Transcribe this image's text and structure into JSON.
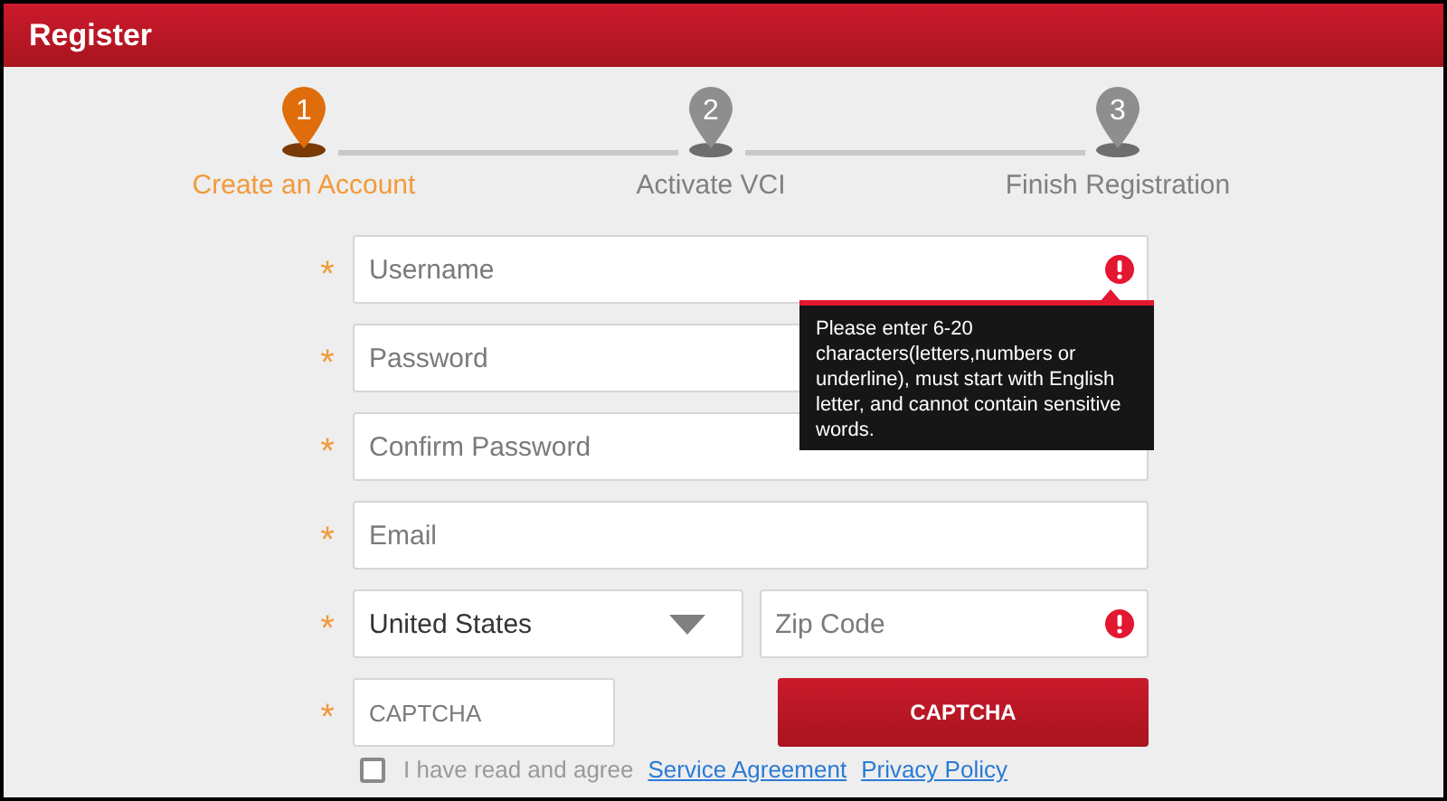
{
  "header": {
    "title": "Register"
  },
  "steps": [
    {
      "number": "1",
      "label": "Create an Account",
      "selected": true
    },
    {
      "number": "2",
      "label": "Activate VCI",
      "selected": false
    },
    {
      "number": "3",
      "label": "Finish Registration",
      "selected": false
    }
  ],
  "form_rows": [
    {
      "kind": "full",
      "required_mark": "*",
      "items": [
        {
          "kind": "input",
          "placeholder": "Username",
          "error": true
        }
      ]
    },
    {
      "kind": "full",
      "required_mark": "*",
      "items": [
        {
          "kind": "input",
          "placeholder": "Password",
          "error": false
        }
      ]
    },
    {
      "kind": "full",
      "required_mark": "*",
      "items": [
        {
          "kind": "input",
          "placeholder": "Confirm Password",
          "error": false
        }
      ]
    },
    {
      "kind": "full",
      "required_mark": "*",
      "items": [
        {
          "kind": "input",
          "placeholder": "Email",
          "error": false
        }
      ]
    },
    {
      "kind": "pair",
      "required_mark": "*",
      "items": [
        {
          "kind": "select",
          "value": "United States"
        },
        {
          "kind": "input",
          "placeholder": "Zip Code",
          "error": true
        }
      ]
    },
    {
      "kind": "captcha",
      "required_mark": "*",
      "items": [
        {
          "kind": "input",
          "placeholder": "CAPTCHA",
          "error": false
        },
        {
          "kind": "button",
          "label": "CAPTCHA"
        }
      ]
    }
  ],
  "tooltip": {
    "text": "Please enter 6-20 characters(letters,numbers or underline), must start with English letter, and cannot contain sensitive words."
  },
  "agreement": {
    "checked": false,
    "text": "I have read and agree",
    "links": [
      "Service Agreement",
      "Privacy Policy"
    ]
  }
}
